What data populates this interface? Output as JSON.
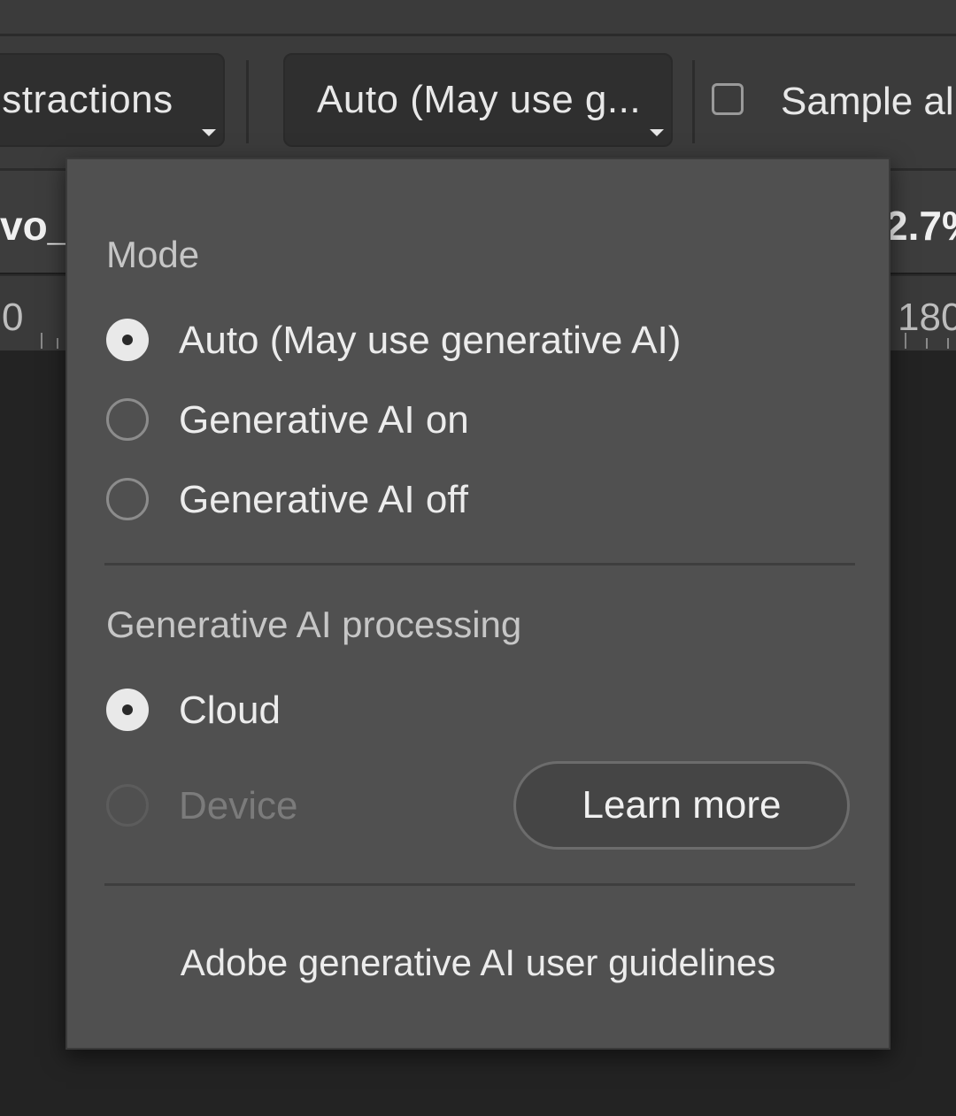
{
  "options_bar": {
    "dropdown_1_label": "istractions",
    "dropdown_2_label": "Auto (May use g...",
    "checkbox_label": "Sample al"
  },
  "document": {
    "tab_name": "vo_",
    "zoom": "2.7%",
    "ruler_left": "0",
    "ruler_right": "180"
  },
  "popup": {
    "mode_title": "Mode",
    "mode_options": [
      {
        "label": "Auto (May use generative AI)",
        "selected": true
      },
      {
        "label": "Generative AI on",
        "selected": false
      },
      {
        "label": "Generative AI off",
        "selected": false
      }
    ],
    "processing_title": "Generative AI processing",
    "processing_options": [
      {
        "label": "Cloud",
        "selected": true,
        "disabled": false
      },
      {
        "label": "Device",
        "selected": false,
        "disabled": true
      }
    ],
    "learn_more_label": "Learn more",
    "guidelines_link": "Adobe generative AI user guidelines"
  }
}
